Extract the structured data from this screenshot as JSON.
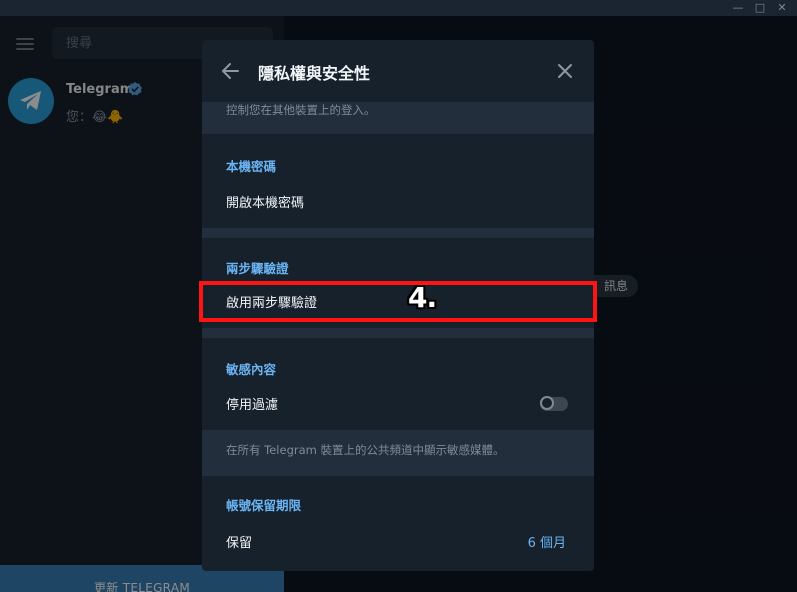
{
  "window": {
    "minimize_glyph": "—",
    "maximize_glyph": "□",
    "close_glyph": "✕"
  },
  "sidebar": {
    "search_placeholder": "搜尋",
    "chats": [
      {
        "name": "Telegram",
        "preview": "您：😂🐥",
        "verified": true
      }
    ],
    "update_button": "更新 TELEGRAM"
  },
  "chat_area": {
    "service_pill": "訊息"
  },
  "modal": {
    "title": "隱私權與安全性",
    "top_note": "控制您在其他裝置上的登入。",
    "sections": {
      "passcode": {
        "header": "本機密碼",
        "row_label": "開啟本機密碼"
      },
      "two_step": {
        "header": "兩步驟驗證",
        "row_label": "啟用兩步驟驗證"
      },
      "sensitive": {
        "header": "敏感內容",
        "row_label": "停用過濾",
        "toggle_on": false,
        "note": "在所有 Telegram 裝置上的公共頻道中顯示敏感媒體。"
      },
      "ttl": {
        "header": "帳號保留期限",
        "row_label": "保留",
        "row_value": "6 個月"
      }
    }
  },
  "annotation": {
    "step_label": "4."
  },
  "colors": {
    "accent": "#6ab3f3",
    "highlight": "#ff1414",
    "modal_bg": "#17212b",
    "band_bg": "#232e3c"
  }
}
